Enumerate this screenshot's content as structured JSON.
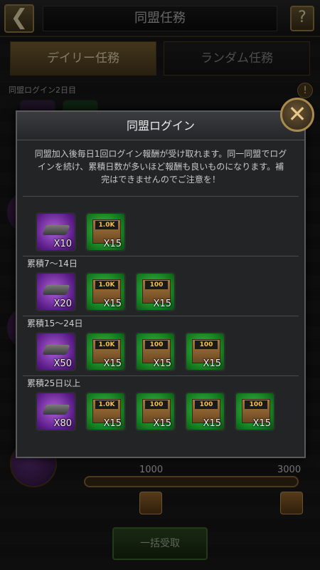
{
  "screen": {
    "title": "同盟任務",
    "back_icon": "back-arrow-icon",
    "help_label": "?",
    "tabs": [
      {
        "label": "デイリー任務",
        "active": true
      },
      {
        "label": "ランダム任務",
        "active": false
      }
    ],
    "caption": "同盟ログイン2日目",
    "alert_label": "!",
    "progress": {
      "min_label": "1000",
      "max_label": "3000",
      "fill_fraction": 0.0
    },
    "claim_all_label": "一括受取"
  },
  "modal": {
    "title": "同盟ログイン",
    "close_label": "✕",
    "description": "同盟加入後毎日1回ログイン報酬が受け取れます。同一同盟でログインを続け、累積日数が多いほど報酬も良いものになります。補完はできませんのでご注意を！",
    "tiers": [
      {
        "label": "",
        "items": [
          {
            "kind": "purple",
            "crate_label": "",
            "qty": "X10"
          },
          {
            "kind": "green",
            "crate_label": "1.0K",
            "qty": "X15"
          }
        ]
      },
      {
        "label": "累積7〜14日",
        "items": [
          {
            "kind": "purple",
            "crate_label": "",
            "qty": "X20"
          },
          {
            "kind": "green",
            "crate_label": "1.0K",
            "qty": "X15"
          },
          {
            "kind": "green",
            "crate_label": "100",
            "qty": "X15"
          }
        ]
      },
      {
        "label": "累積15〜24日",
        "items": [
          {
            "kind": "purple",
            "crate_label": "",
            "qty": "X50"
          },
          {
            "kind": "green",
            "crate_label": "1.0K",
            "qty": "X15"
          },
          {
            "kind": "green",
            "crate_label": "100",
            "qty": "X15"
          },
          {
            "kind": "green",
            "crate_label": "100",
            "qty": "X15"
          }
        ]
      },
      {
        "label": "累積25日以上",
        "items": [
          {
            "kind": "purple",
            "crate_label": "",
            "qty": "X80"
          },
          {
            "kind": "green",
            "crate_label": "1.0K",
            "qty": "X15"
          },
          {
            "kind": "green",
            "crate_label": "100",
            "qty": "X15"
          },
          {
            "kind": "green",
            "crate_label": "100",
            "qty": "X15"
          },
          {
            "kind": "green",
            "crate_label": "100",
            "qty": "X15"
          }
        ]
      }
    ]
  }
}
